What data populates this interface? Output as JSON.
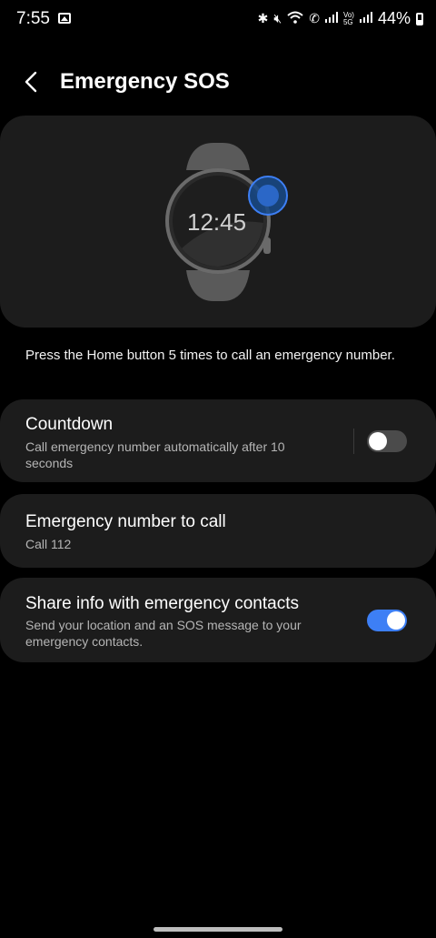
{
  "status_bar": {
    "time": "7:55",
    "battery": "44%"
  },
  "header": {
    "title": "Emergency SOS"
  },
  "hero": {
    "watch_time": "12:45"
  },
  "description": "Press the Home button 5 times to call an emergency number.",
  "countdown": {
    "title": "Countdown",
    "subtitle": "Call emergency number automatically after 10 seconds",
    "enabled": false
  },
  "emergency_number": {
    "title": "Emergency number to call",
    "subtitle": "Call 112"
  },
  "share_info": {
    "title": "Share info with emergency contacts",
    "subtitle": "Send your location and an SOS message to your emergency contacts.",
    "enabled": true
  },
  "colors": {
    "accent": "#3d7ff5",
    "card": "#1c1c1c",
    "background": "#000000"
  }
}
